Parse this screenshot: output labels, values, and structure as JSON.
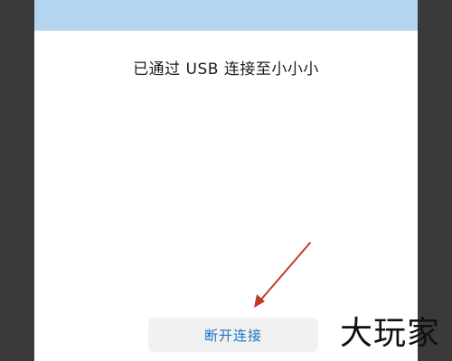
{
  "dialog": {
    "message": "已通过 USB 连接至小小小",
    "disconnect_label": "断开连接"
  },
  "watermark": {
    "text": "大玩家"
  },
  "colors": {
    "background": "#3a3a3a",
    "dialog": "#ffffff",
    "header": "#b3d5f0",
    "button_bg": "#f1f1f1",
    "button_text": "#1a73c8",
    "annotation_arrow": "#c0392b"
  },
  "icons": {
    "annotation": "arrow-icon"
  }
}
